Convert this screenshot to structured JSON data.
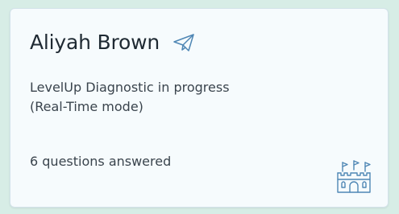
{
  "card": {
    "student_name": "Aliyah Brown",
    "status_line_1": "LevelUp Diagnostic in progress",
    "status_line_2": "(Real-Time mode)",
    "questions_answered": "6 questions answered",
    "send_icon": "paper-plane-icon",
    "badge_icon": "castle-icon"
  },
  "colors": {
    "background": "#d7ede6",
    "card": "#f6fbfd",
    "icon_stroke": "#4f87b5"
  }
}
